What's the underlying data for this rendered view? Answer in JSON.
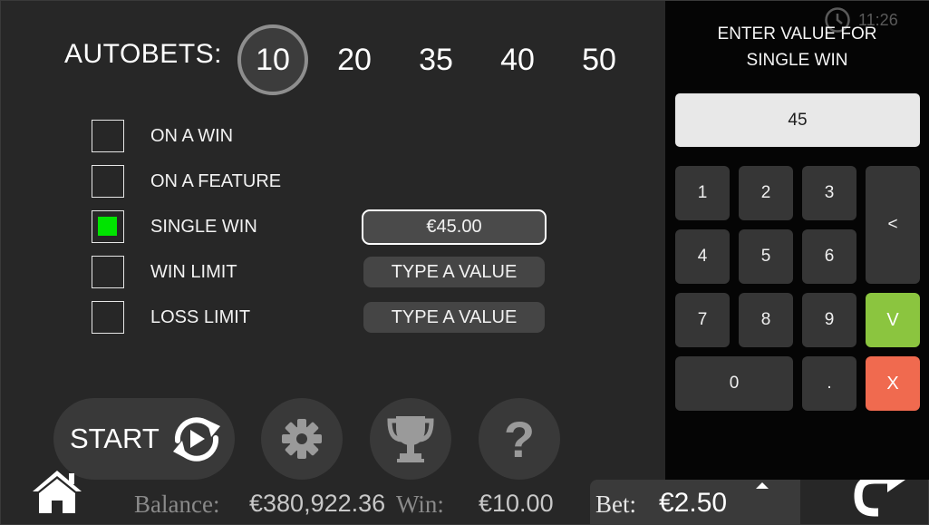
{
  "autobets": {
    "label": "AUTOBETS:",
    "options": [
      "10",
      "20",
      "35",
      "40",
      "50"
    ],
    "selected": "10"
  },
  "stop_options": [
    {
      "label": "ON A WIN",
      "checked": false,
      "value": null
    },
    {
      "label": "ON A FEATURE",
      "checked": false,
      "value": null
    },
    {
      "label": "SINGLE WIN",
      "checked": true,
      "value": "€45.00"
    },
    {
      "label": "WIN LIMIT",
      "checked": false,
      "value": "TYPE A VALUE"
    },
    {
      "label": "LOSS LIMIT",
      "checked": false,
      "value": "TYPE A VALUE"
    }
  ],
  "controls": {
    "start_label": "START",
    "settings_icon": "gear-icon",
    "trophy_icon": "trophy-icon",
    "help_label": "?"
  },
  "status_bar": {
    "balance_label": "Balance:",
    "balance_value": "€380,922.36",
    "win_label": "Win:",
    "win_value": "€10.00",
    "bet_label": "Bet:",
    "bet_value": "€2.50"
  },
  "clock": {
    "time": "11:26"
  },
  "keypad": {
    "title_line1": "ENTER VALUE FOR",
    "title_line2": "SINGLE WIN",
    "display_value": "45",
    "keys": {
      "k1": "1",
      "k2": "2",
      "k3": "3",
      "k4": "4",
      "k5": "5",
      "k6": "6",
      "k7": "7",
      "k8": "8",
      "k9": "9",
      "k0": "0",
      "dot": ".",
      "backspace": "<",
      "confirm": "V",
      "cancel": "X"
    }
  },
  "colors": {
    "background": "#272727",
    "keypad_background": "#050505",
    "checked_green": "#00e400",
    "confirm_green": "#8bc53f",
    "cancel_red": "#f06a4f"
  }
}
